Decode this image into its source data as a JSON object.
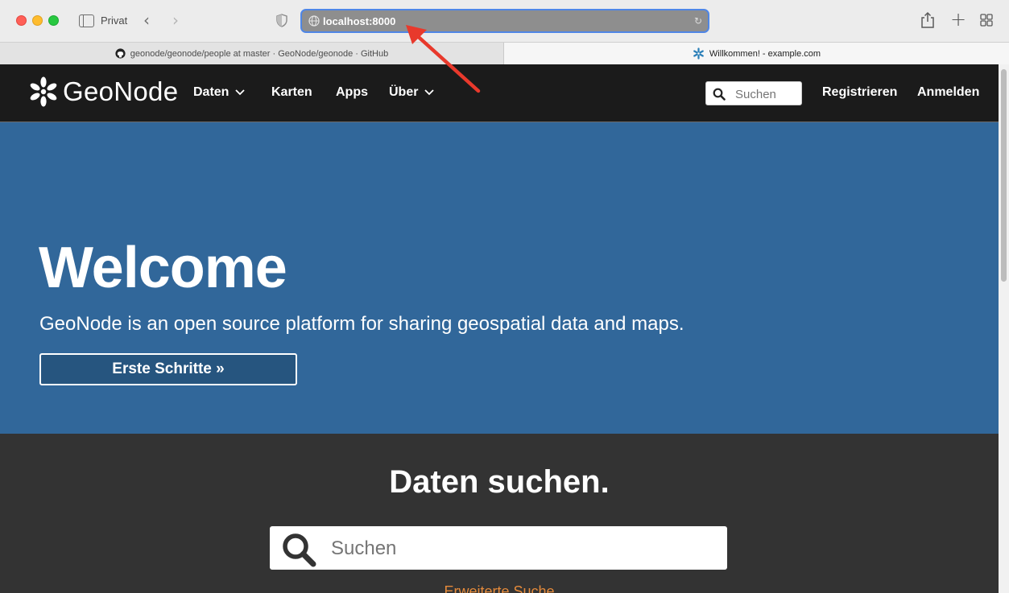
{
  "browser": {
    "private_label": "Privat",
    "address": "localhost:8000",
    "tabs": [
      {
        "label": "geonode/geonode/people at master · GeoNode/geonode · GitHub"
      },
      {
        "label": "Willkommen! - example.com"
      }
    ]
  },
  "site": {
    "brand": "GeoNode",
    "nav": {
      "items": [
        {
          "label": "Daten"
        },
        {
          "label": "Karten"
        },
        {
          "label": "Apps"
        },
        {
          "label": "Über"
        }
      ],
      "search_placeholder": "Suchen",
      "register": "Registrieren",
      "login": "Anmelden"
    },
    "hero": {
      "title": "Welcome",
      "subtitle": "GeoNode is an open source platform for sharing geospatial data and maps.",
      "button": "Erste Schritte »"
    },
    "search": {
      "title": "Daten suchen.",
      "placeholder": "Suchen",
      "advanced": "Erweiterte Suche"
    }
  },
  "colors": {
    "nav_bg": "#1b1b1b",
    "hero_bg": "#31679a",
    "section_bg": "#333333",
    "accent_link": "#e48a3b",
    "annotation": "#e8392c",
    "address_focus": "#4f86e6"
  }
}
